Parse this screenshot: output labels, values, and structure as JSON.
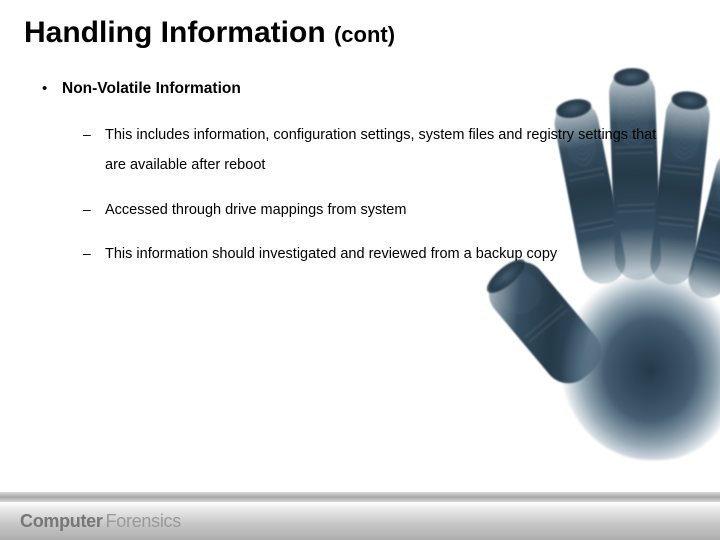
{
  "title_main": "Handling Information",
  "title_cont": "(cont)",
  "section_heading": "Non-Volatile Information",
  "sub_items": [
    "This includes information, configuration settings, system files and registry settings that are available after reboot",
    "Accessed through drive mappings from system",
    "This information should investigated and reviewed from a backup copy"
  ],
  "footer": {
    "word1": "Computer",
    "word2": "Forensics"
  }
}
